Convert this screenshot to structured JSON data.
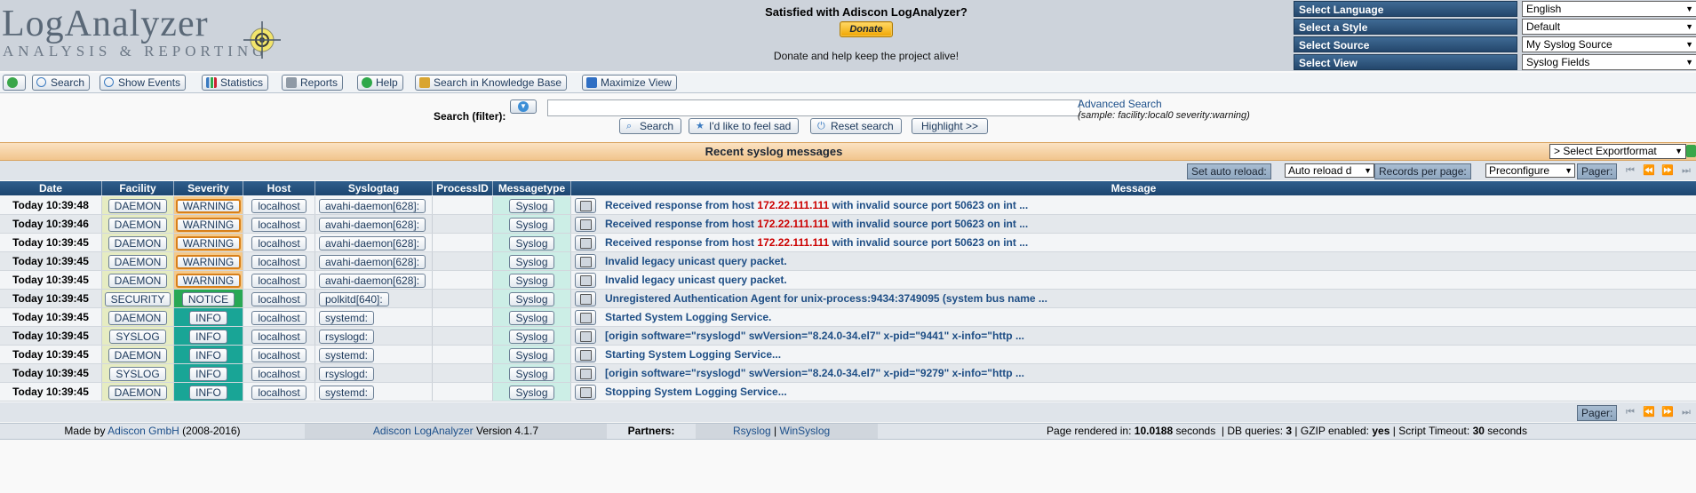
{
  "header": {
    "logo_main": "LogAnalyzer",
    "logo_sub": "ANALYSIS & REPORTING",
    "donate_title": "Satisfied with Adiscon LogAnalyzer?",
    "donate_button": "Donate",
    "donate_note": "Donate and help keep the project alive!",
    "selectors": [
      {
        "label": "Select Language",
        "value": "English"
      },
      {
        "label": "Select a Style",
        "value": "Default"
      },
      {
        "label": "Select Source",
        "value": "My Syslog Source"
      },
      {
        "label": "Select View",
        "value": "Syslog Fields"
      }
    ]
  },
  "menu": {
    "search": "Search",
    "show_events": "Show Events",
    "statistics": "Statistics",
    "reports": "Reports",
    "help": "Help",
    "knowledge_base": "Search in Knowledge Base",
    "maximize": "Maximize View"
  },
  "search": {
    "label": "Search (filter):",
    "value": "",
    "advanced": "Advanced Search",
    "sample": "(sample: facility:local0 severity:warning)",
    "btn_search": "Search",
    "btn_sad": "I'd like to feel sad",
    "btn_reset": "Reset search",
    "btn_highlight": "Highlight >>"
  },
  "titlebar": {
    "title": "Recent syslog messages",
    "export": "> Select Exportformat"
  },
  "pager": {
    "auto_reload_label": "Set auto reload:",
    "auto_reload_value": "Auto reload d",
    "records_label": "Records per page:",
    "records_value": "Preconfigure",
    "pager_label": "Pager:"
  },
  "table": {
    "columns": [
      "Date",
      "Facility",
      "Severity",
      "Host",
      "Syslogtag",
      "ProcessID",
      "Messagetype",
      "Message"
    ],
    "rows": [
      {
        "date": "Today 10:39:48",
        "facility": "DAEMON",
        "severity": "WARNING",
        "host": "localhost",
        "tag": "avahi-daemon[628]:",
        "pid": "",
        "mtype": "Syslog",
        "msg_a": "Received response from host ",
        "msg_ip": "172.22.111.111",
        "msg_b": " with invalid source port 50623 on int ..."
      },
      {
        "date": "Today 10:39:46",
        "facility": "DAEMON",
        "severity": "WARNING",
        "host": "localhost",
        "tag": "avahi-daemon[628]:",
        "pid": "",
        "mtype": "Syslog",
        "msg_a": "Received response from host ",
        "msg_ip": "172.22.111.111",
        "msg_b": " with invalid source port 50623 on int ..."
      },
      {
        "date": "Today 10:39:45",
        "facility": "DAEMON",
        "severity": "WARNING",
        "host": "localhost",
        "tag": "avahi-daemon[628]:",
        "pid": "",
        "mtype": "Syslog",
        "msg_a": "Received response from host ",
        "msg_ip": "172.22.111.111",
        "msg_b": " with invalid source port 50623 on int ..."
      },
      {
        "date": "Today 10:39:45",
        "facility": "DAEMON",
        "severity": "WARNING",
        "host": "localhost",
        "tag": "avahi-daemon[628]:",
        "pid": "",
        "mtype": "Syslog",
        "msg_a": "Invalid legacy unicast query packet.",
        "msg_ip": "",
        "msg_b": ""
      },
      {
        "date": "Today 10:39:45",
        "facility": "DAEMON",
        "severity": "WARNING",
        "host": "localhost",
        "tag": "avahi-daemon[628]:",
        "pid": "",
        "mtype": "Syslog",
        "msg_a": "Invalid legacy unicast query packet.",
        "msg_ip": "",
        "msg_b": ""
      },
      {
        "date": "Today 10:39:45",
        "facility": "SECURITY",
        "severity": "NOTICE",
        "host": "localhost",
        "tag": "polkitd[640]:",
        "pid": "",
        "mtype": "Syslog",
        "msg_a": "Unregistered Authentication Agent for unix-process:9434:3749095 (system bus name ...",
        "msg_ip": "",
        "msg_b": ""
      },
      {
        "date": "Today 10:39:45",
        "facility": "DAEMON",
        "severity": "INFO",
        "host": "localhost",
        "tag": "systemd:",
        "pid": "",
        "mtype": "Syslog",
        "msg_a": "Started System Logging Service.",
        "msg_ip": "",
        "msg_b": ""
      },
      {
        "date": "Today 10:39:45",
        "facility": "SYSLOG",
        "severity": "INFO",
        "host": "localhost",
        "tag": "rsyslogd:",
        "pid": "",
        "mtype": "Syslog",
        "msg_a": "[origin software=\"rsyslogd\" swVersion=\"8.24.0-34.el7\" x-pid=\"9441\" x-info=\"http ...",
        "msg_ip": "",
        "msg_b": ""
      },
      {
        "date": "Today 10:39:45",
        "facility": "DAEMON",
        "severity": "INFO",
        "host": "localhost",
        "tag": "systemd:",
        "pid": "",
        "mtype": "Syslog",
        "msg_a": "Starting System Logging Service...",
        "msg_ip": "",
        "msg_b": ""
      },
      {
        "date": "Today 10:39:45",
        "facility": "SYSLOG",
        "severity": "INFO",
        "host": "localhost",
        "tag": "rsyslogd:",
        "pid": "",
        "mtype": "Syslog",
        "msg_a": "[origin software=\"rsyslogd\" swVersion=\"8.24.0-34.el7\" x-pid=\"9279\" x-info=\"http ...",
        "msg_ip": "",
        "msg_b": ""
      },
      {
        "date": "Today 10:39:45",
        "facility": "DAEMON",
        "severity": "INFO",
        "host": "localhost",
        "tag": "systemd:",
        "pid": "",
        "mtype": "Syslog",
        "msg_a": "Stopping System Logging Service...",
        "msg_ip": "",
        "msg_b": ""
      }
    ]
  },
  "footer": {
    "made_by": "Made by",
    "company": "Adiscon GmbH",
    "years": "(2008-2016)",
    "product": "Adiscon LogAnalyzer",
    "version": "Version 4.1.7",
    "partners_label": "Partners:",
    "partner1": "Rsyslog",
    "separator": "|",
    "partner2": "WinSyslog",
    "render_label": "Page rendered in:",
    "render_time": "10.0188",
    "render_unit": "seconds",
    "db_label": "| DB queries:",
    "db_value": "3",
    "gzip_label": "| GZIP enabled:",
    "gzip_value": "yes",
    "timeout_label": "| Script Timeout:",
    "timeout_value": "30",
    "timeout_unit": "seconds"
  },
  "colors": {
    "header_bg": "#cdd3db",
    "table_header": "#1d4670",
    "warning": "#d8801a",
    "notice": "#28a854",
    "info": "#19a596",
    "link": "#1c4f8a",
    "ip": "#cc0000"
  }
}
